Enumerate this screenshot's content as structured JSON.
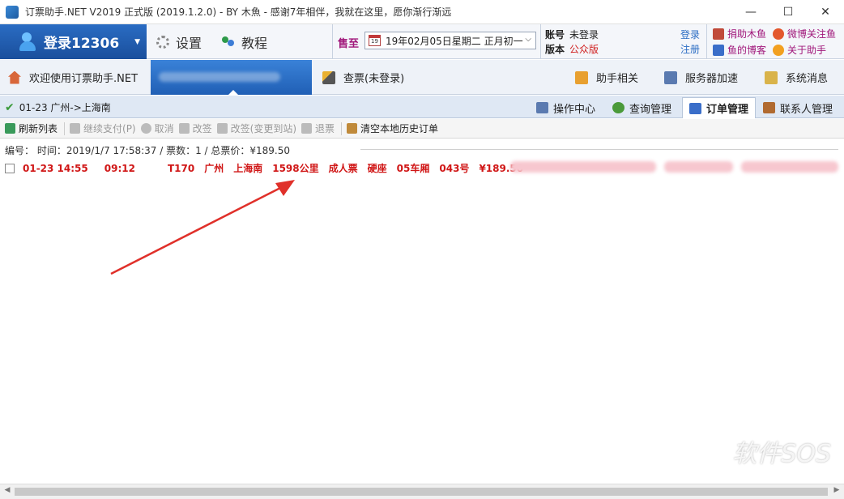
{
  "window": {
    "title": "订票助手.NET V2019 正式版 (2019.1.2.0) - BY 木魚 - 感谢7年相伴，我就在这里，愿你渐行渐远",
    "minimize": "—",
    "maximize": "☐",
    "close": "✕"
  },
  "header": {
    "login_label": "登录12306",
    "settings_label": "设置",
    "tutorial_label": "教程",
    "sale_label": "售至",
    "date_value": "19年02月05日星期二  正月初一",
    "cal_day": "19",
    "account_label": "账号",
    "account_value": "未登录",
    "version_label": "版本",
    "version_value": "公众版",
    "login_link": "登录",
    "register_link": "注册",
    "donate": "捐助木鱼",
    "weibo": "微博关注鱼",
    "blog": "鱼的博客",
    "about": "关于助手"
  },
  "nav": {
    "welcome": "欢迎使用订票助手.NET",
    "query": "查票(未登录)",
    "helper": "助手相关",
    "server": "服务器加速",
    "messages": "系统消息"
  },
  "tabs": {
    "route": "01-23  广州->上海南",
    "ops_center": "操作中心",
    "query_mgmt": "查询管理",
    "order_mgmt": "订单管理",
    "contacts_mgmt": "联系人管理"
  },
  "toolbar": {
    "refresh": "刷新列表",
    "continue_pay": "继续支付(P)",
    "cancel": "取消",
    "change": "改签",
    "change_station": "改签(变更到站)",
    "refund": "退票",
    "clear_history": "清空本地历史订单"
  },
  "order": {
    "group_header": "编号：          时间：2019/1/7 17:58:37 / 票数：1 / 总票价：¥189.50",
    "depart_time": "01-23 14:55",
    "arrive_time": "09:12",
    "train": "T170",
    "from": "广州",
    "to": "上海南",
    "distance": "1598公里",
    "ticket_type": "成人票",
    "seat_class": "硬座",
    "car": "05车厢",
    "seat": "043号",
    "price": "¥189.50"
  },
  "watermark": "软件SOS"
}
